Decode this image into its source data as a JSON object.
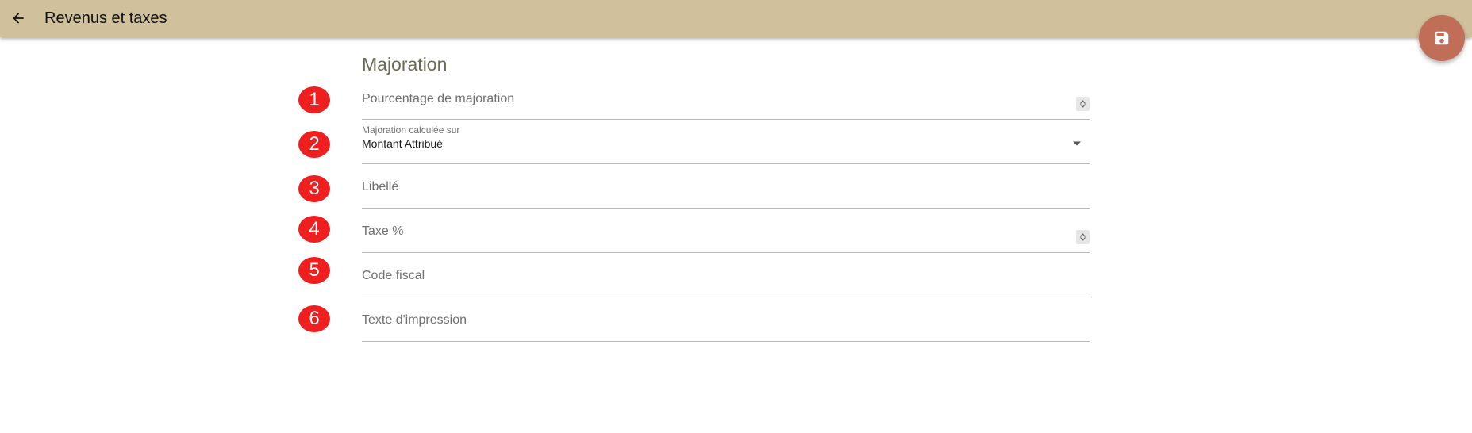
{
  "appbar": {
    "title": "Revenus et taxes",
    "back_icon": "arrow-left-icon",
    "color": "#d0c09c"
  },
  "fab": {
    "icon": "save-icon",
    "color": "#c16e58"
  },
  "form": {
    "section_title": "Majoration",
    "badge_color": "#ef1f1f",
    "fields": [
      {
        "number": "1",
        "label": "Pourcentage de majoration",
        "type": "number",
        "value": ""
      },
      {
        "number": "2",
        "label": "Majoration calculée sur",
        "type": "select",
        "value": "Montant Attribué"
      },
      {
        "number": "3",
        "label": "Libellé",
        "type": "text",
        "value": ""
      },
      {
        "number": "4",
        "label": "Taxe %",
        "type": "number",
        "value": ""
      },
      {
        "number": "5",
        "label": "Code fiscal",
        "type": "text",
        "value": ""
      },
      {
        "number": "6",
        "label": "Texte d'impression",
        "type": "text",
        "value": ""
      }
    ]
  }
}
